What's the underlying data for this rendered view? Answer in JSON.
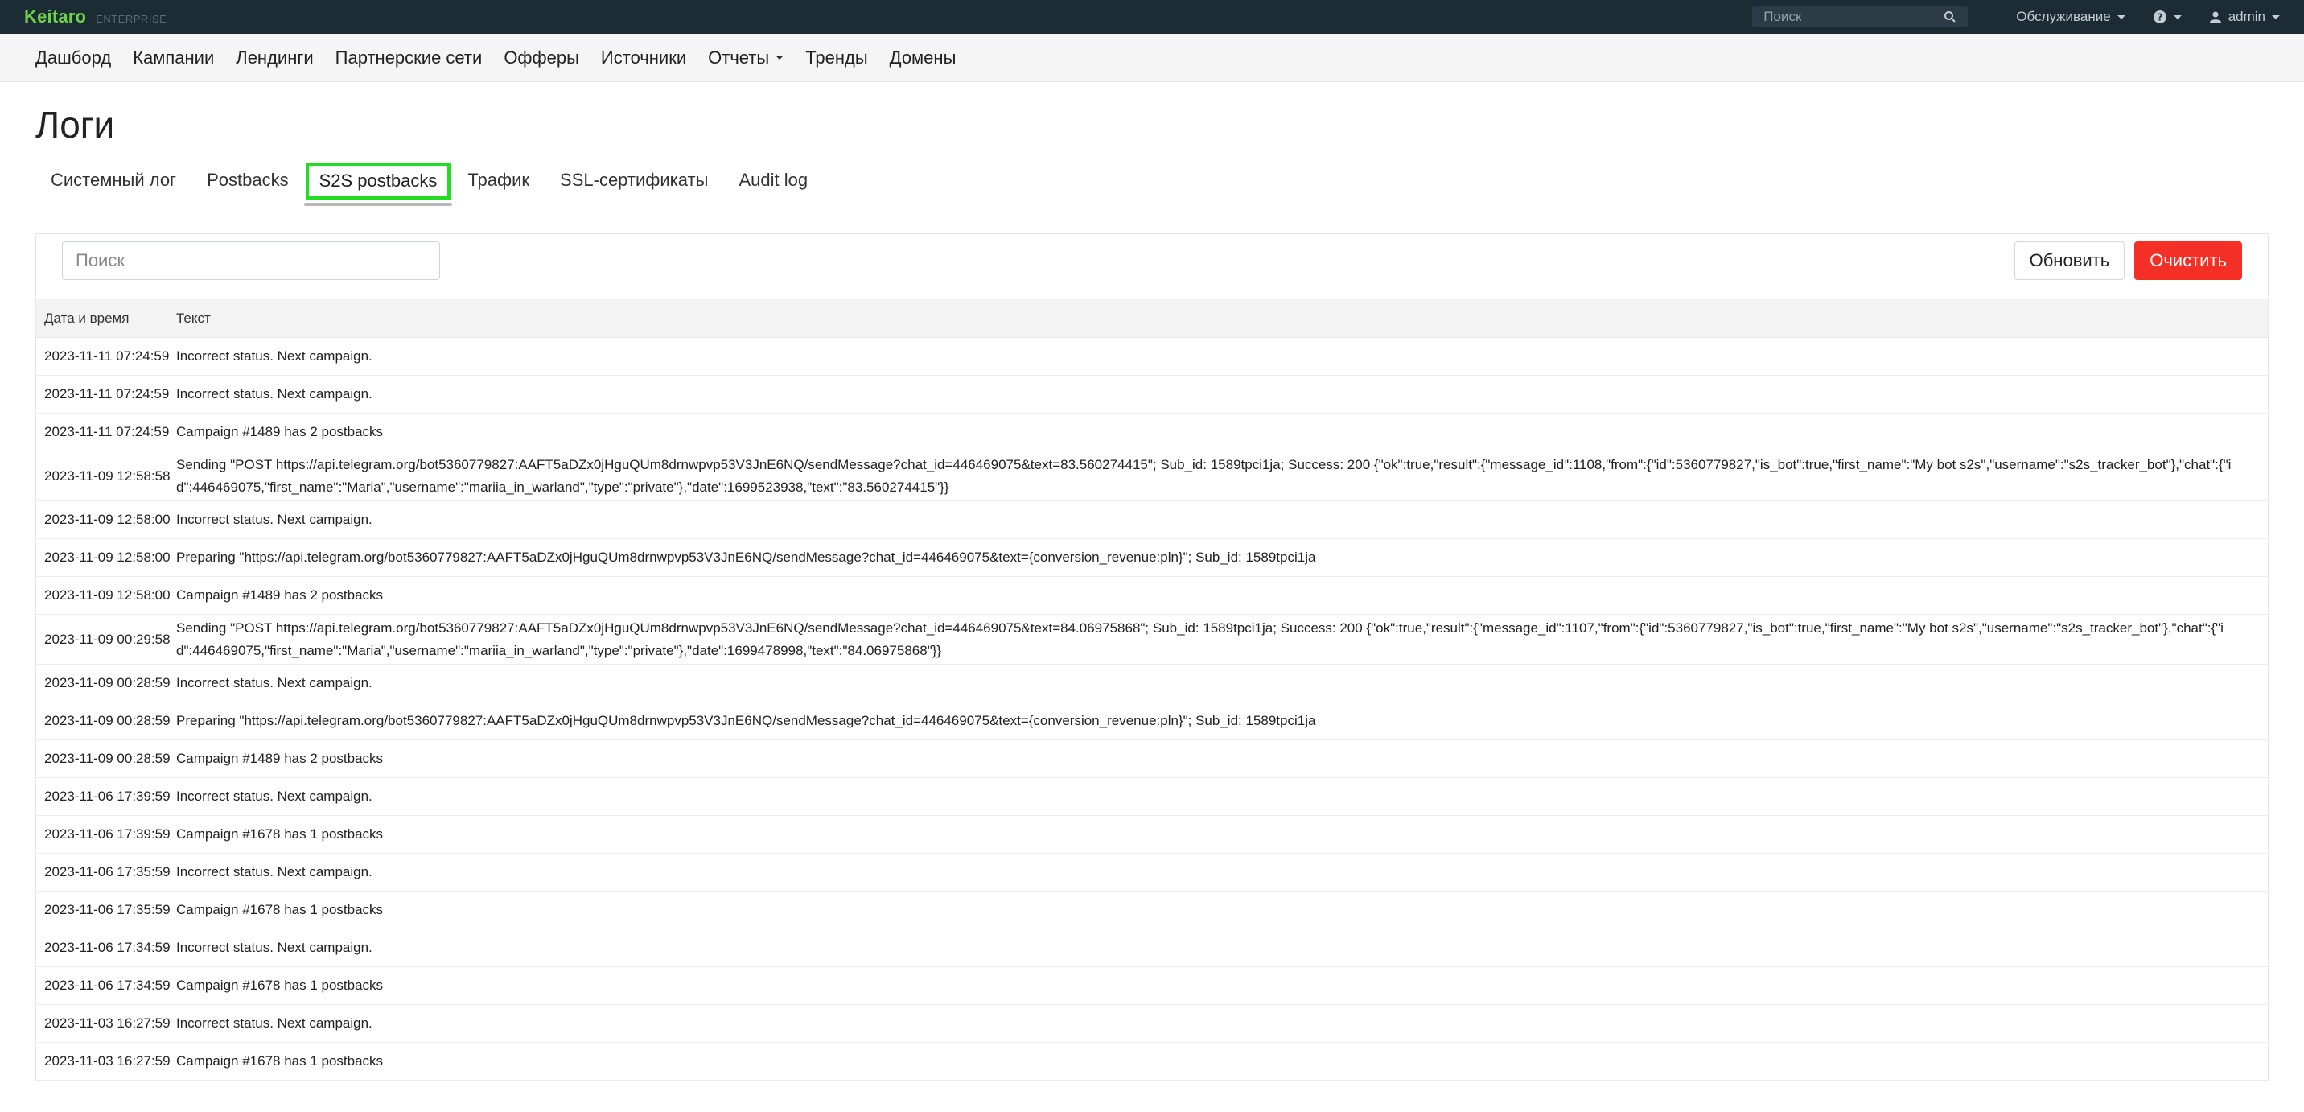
{
  "app": {
    "brand": "Keitaro",
    "edition": "ENTERPRISE"
  },
  "topbar": {
    "search_placeholder": "Поиск",
    "service_label": "Обслуживание",
    "user_label": "admin"
  },
  "nav": {
    "items": [
      "Дашборд",
      "Кампании",
      "Лендинги",
      "Партнерские сети",
      "Офферы",
      "Источники",
      "Отчеты",
      "Тренды",
      "Домены"
    ]
  },
  "page": {
    "title": "Логи"
  },
  "tabs": [
    "Системный лог",
    "Postbacks",
    "S2S postbacks",
    "Трафик",
    "SSL-сертификаты",
    "Audit log"
  ],
  "active_tab": "S2S postbacks",
  "toolbar": {
    "search_placeholder": "Поиск",
    "refresh_label": "Обновить",
    "clear_label": "Очистить"
  },
  "colors": {
    "accent_green": "#6ed14a",
    "danger": "#f43026",
    "topbar_bg": "#1c2c35",
    "active_tab_outline": "#22dd22"
  },
  "table": {
    "headers": {
      "date": "Дата и время",
      "text": "Текст"
    },
    "rows": [
      {
        "date": "2023-11-11 07:24:59",
        "text": "Incorrect status. Next campaign."
      },
      {
        "date": "2023-11-11 07:24:59",
        "text": "Incorrect status. Next campaign."
      },
      {
        "date": "2023-11-11 07:24:59",
        "text": "Campaign #1489 has 2 postbacks"
      },
      {
        "date": "2023-11-09 12:58:58",
        "text": "Sending \"POST https://api.telegram.org/bot5360779827:AAFT5aDZx0jHguQUm8drnwpvp53V3JnE6NQ/sendMessage?chat_id=446469075&text=83.560274415\"; Sub_id: 1589tpci1ja; Success: 200 {\"ok\":true,\"result\":{\"message_id\":1108,\"from\":{\"id\":5360779827,\"is_bot\":true,\"first_name\":\"My bot s2s\",\"username\":\"s2s_tracker_bot\"},\"chat\":{\"id\":446469075,\"first_name\":\"Maria\",\"username\":\"mariia_in_warland\",\"type\":\"private\"},\"date\":1699523938,\"text\":\"83.560274415\"}}"
      },
      {
        "date": "2023-11-09 12:58:00",
        "text": "Incorrect status. Next campaign."
      },
      {
        "date": "2023-11-09 12:58:00",
        "text": "Preparing \"https://api.telegram.org/bot5360779827:AAFT5aDZx0jHguQUm8drnwpvp53V3JnE6NQ/sendMessage?chat_id=446469075&text={conversion_revenue:pln}\"; Sub_id: 1589tpci1ja"
      },
      {
        "date": "2023-11-09 12:58:00",
        "text": "Campaign #1489 has 2 postbacks"
      },
      {
        "date": "2023-11-09 00:29:58",
        "text": "Sending \"POST https://api.telegram.org/bot5360779827:AAFT5aDZx0jHguQUm8drnwpvp53V3JnE6NQ/sendMessage?chat_id=446469075&text=84.06975868\"; Sub_id: 1589tpci1ja; Success: 200 {\"ok\":true,\"result\":{\"message_id\":1107,\"from\":{\"id\":5360779827,\"is_bot\":true,\"first_name\":\"My bot s2s\",\"username\":\"s2s_tracker_bot\"},\"chat\":{\"id\":446469075,\"first_name\":\"Maria\",\"username\":\"mariia_in_warland\",\"type\":\"private\"},\"date\":1699478998,\"text\":\"84.06975868\"}}"
      },
      {
        "date": "2023-11-09 00:28:59",
        "text": "Incorrect status. Next campaign."
      },
      {
        "date": "2023-11-09 00:28:59",
        "text": "Preparing \"https://api.telegram.org/bot5360779827:AAFT5aDZx0jHguQUm8drnwpvp53V3JnE6NQ/sendMessage?chat_id=446469075&text={conversion_revenue:pln}\"; Sub_id: 1589tpci1ja"
      },
      {
        "date": "2023-11-09 00:28:59",
        "text": "Campaign #1489 has 2 postbacks"
      },
      {
        "date": "2023-11-06 17:39:59",
        "text": "Incorrect status. Next campaign."
      },
      {
        "date": "2023-11-06 17:39:59",
        "text": "Campaign #1678 has 1 postbacks"
      },
      {
        "date": "2023-11-06 17:35:59",
        "text": "Incorrect status. Next campaign."
      },
      {
        "date": "2023-11-06 17:35:59",
        "text": "Campaign #1678 has 1 postbacks"
      },
      {
        "date": "2023-11-06 17:34:59",
        "text": "Incorrect status. Next campaign."
      },
      {
        "date": "2023-11-06 17:34:59",
        "text": "Campaign #1678 has 1 postbacks"
      },
      {
        "date": "2023-11-03 16:27:59",
        "text": "Incorrect status. Next campaign."
      },
      {
        "date": "2023-11-03 16:27:59",
        "text": "Campaign #1678 has 1 postbacks"
      }
    ]
  }
}
